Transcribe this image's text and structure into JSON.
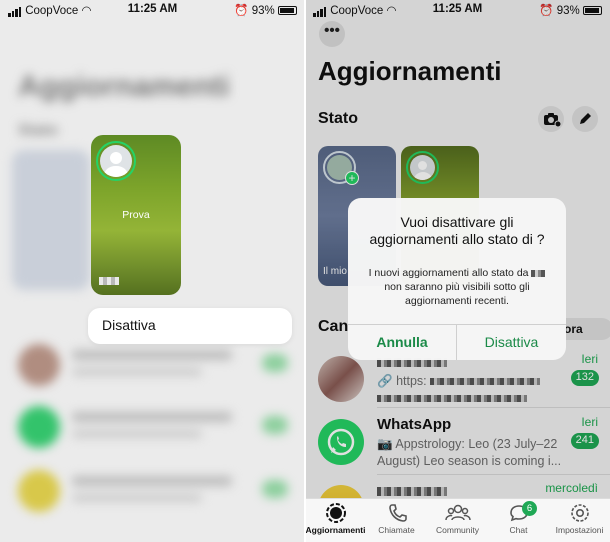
{
  "status_left": {
    "carrier": "CoopVoce",
    "time": "11:25 AM",
    "battery": "93%"
  },
  "status_right": {
    "carrier": "CoopVoce",
    "time": "11:25 AM",
    "battery": "93%"
  },
  "left": {
    "blurred_title": "Aggiornamenti",
    "blurred_section": "Stato",
    "status_card_name": "Prova",
    "context_menu_item": "Disattiva"
  },
  "right": {
    "more_label": "•••",
    "title": "Aggiornamenti",
    "section_stato": "Stato",
    "my_status_caption": "Il mio",
    "channels_heading": "Can",
    "explore_pill": "ora",
    "channels": [
      {
        "name": "",
        "date": "Ieri",
        "badge": "132",
        "preview": "https:"
      },
      {
        "name": "WhatsApp",
        "date": "Ieri",
        "badge": "241",
        "preview": "Appstrology: Leo (23 July–22 August) Leo season is coming i..."
      },
      {
        "name": "",
        "date": "mercoledì",
        "badge": "",
        "preview": ""
      }
    ],
    "alert": {
      "title": "Vuoi disattivare gli aggiornamenti allo stato di ?",
      "message_part1": "I nuovi aggiornamenti allo stato da",
      "message_part2": "non saranno più visibili sotto gli aggiornamenti recenti.",
      "cancel": "Annulla",
      "confirm": "Disattiva"
    },
    "tabs": [
      {
        "label": "Aggiornamenti",
        "icon": "updates-icon",
        "active": true
      },
      {
        "label": "Chiamate",
        "icon": "phone-icon"
      },
      {
        "label": "Community",
        "icon": "community-icon"
      },
      {
        "label": "Chat",
        "icon": "chat-icon",
        "badge": "6"
      },
      {
        "label": "Impostazioni",
        "icon": "settings-icon"
      }
    ]
  },
  "colors": {
    "accent_green": "#25d366",
    "badge_green": "#1fa855",
    "link_green": "#1b8a48"
  }
}
